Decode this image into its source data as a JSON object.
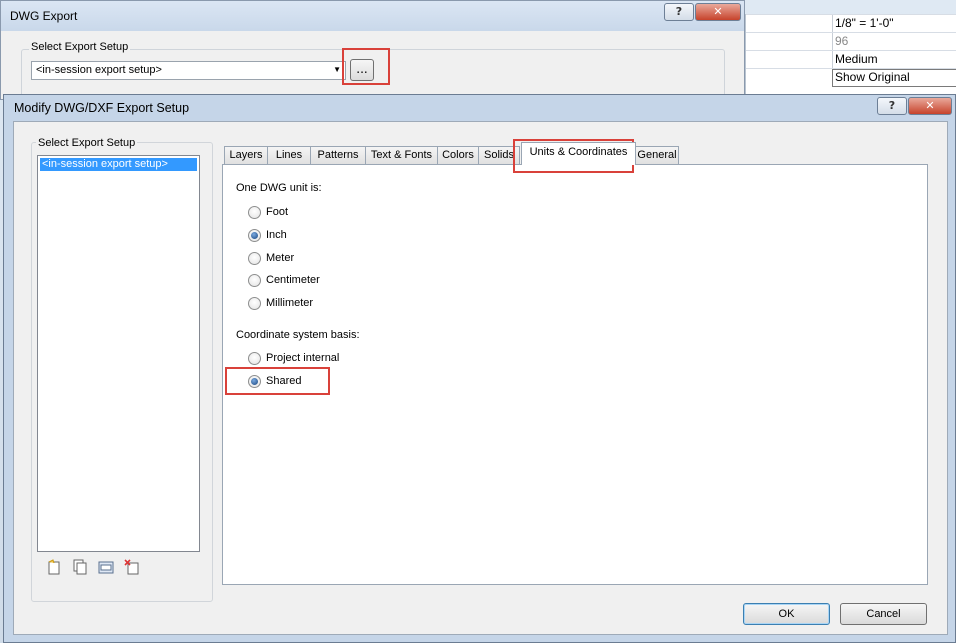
{
  "background_props": {
    "values": [
      "1/8\" = 1'-0\"",
      "96",
      "Medium",
      "Show Original"
    ]
  },
  "dwg_export": {
    "title": "DWG Export",
    "help_label": "?",
    "close_label": "✕",
    "group_label": "Select Export Setup",
    "setup_value": "<in-session export setup>",
    "more_button": "..."
  },
  "modify_dialog": {
    "title": "Modify DWG/DXF Export Setup",
    "help_label": "?",
    "close_label": "✕",
    "left_group_label": "Select Export Setup",
    "setups": [
      "<in-session export setup>"
    ],
    "list_icons": [
      "new-setup-icon",
      "duplicate-setup-icon",
      "rename-setup-icon",
      "delete-setup-icon"
    ],
    "tabs": [
      "Layers",
      "Lines",
      "Patterns",
      "Text & Fonts",
      "Colors",
      "Solids",
      "Units & Coordinates",
      "General"
    ],
    "active_tab": "Units & Coordinates",
    "units_label": "One DWG unit is:",
    "units": [
      {
        "label": "Foot",
        "checked": false
      },
      {
        "label": "Inch",
        "checked": true
      },
      {
        "label": "Meter",
        "checked": false
      },
      {
        "label": "Centimeter",
        "checked": false
      },
      {
        "label": "Millimeter",
        "checked": false
      }
    ],
    "coord_label": "Coordinate system basis:",
    "coords": [
      {
        "label": "Project internal",
        "checked": false
      },
      {
        "label": "Shared",
        "checked": true
      }
    ],
    "ok_label": "OK",
    "cancel_label": "Cancel"
  },
  "colors": {
    "highlight": "#d9413a",
    "selection": "#3399ff"
  }
}
